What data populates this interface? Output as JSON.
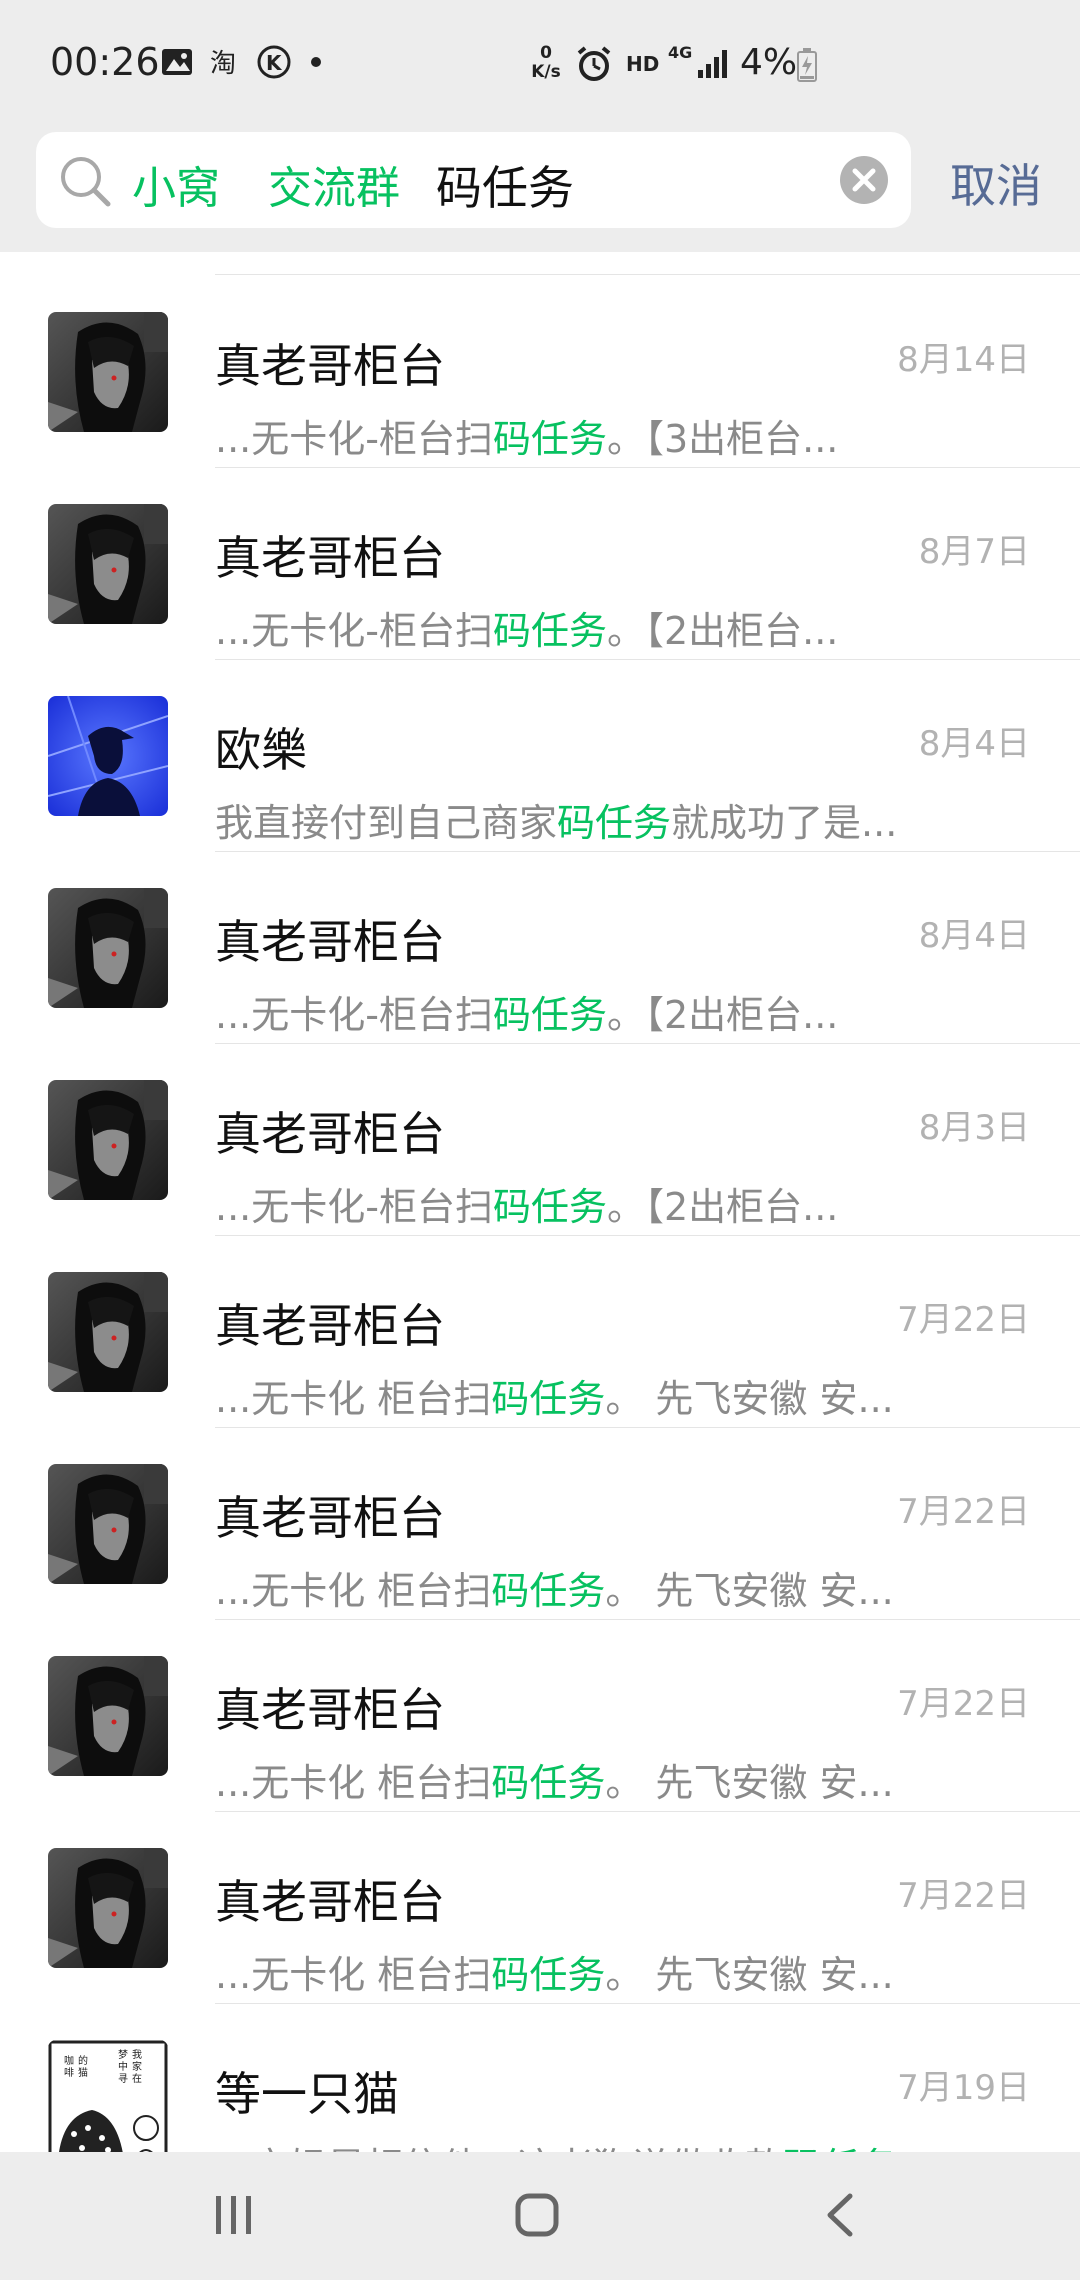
{
  "status_bar": {
    "time": "00:26",
    "net_speed_value": "0",
    "net_speed_unit": "K/s",
    "hd": "HD",
    "network": "4G",
    "battery": "4%"
  },
  "search": {
    "chips": [
      "小窝",
      "交流群"
    ],
    "query": "码任务",
    "cancel_label": "取消"
  },
  "results": [
    {
      "name": "真老哥柜台",
      "date": "8月14日",
      "avatar": "dark",
      "pre": "...无卡化-柜台扫",
      "hl": "码任务",
      "post": "。【3出柜台..."
    },
    {
      "name": "真老哥柜台",
      "date": "8月7日",
      "avatar": "dark",
      "pre": "...无卡化-柜台扫",
      "hl": "码任务",
      "post": "。【2出柜台..."
    },
    {
      "name": "欧樂",
      "date": "8月4日",
      "avatar": "blue",
      "pre": "我直接付到自己商家",
      "hl": "码任务",
      "post": "就成功了是..."
    },
    {
      "name": "真老哥柜台",
      "date": "8月4日",
      "avatar": "dark",
      "pre": "...无卡化-柜台扫",
      "hl": "码任务",
      "post": "。【2出柜台..."
    },
    {
      "name": "真老哥柜台",
      "date": "8月3日",
      "avatar": "dark",
      "pre": "...无卡化-柜台扫",
      "hl": "码任务",
      "post": "。【2出柜台..."
    },
    {
      "name": "真老哥柜台",
      "date": "7月22日",
      "avatar": "dark",
      "pre": "...无卡化 柜台扫",
      "hl": "码任务",
      "post": "。 先飞安徽 安..."
    },
    {
      "name": "真老哥柜台",
      "date": "7月22日",
      "avatar": "dark",
      "pre": "...无卡化 柜台扫",
      "hl": "码任务",
      "post": "。 先飞安徽 安..."
    },
    {
      "name": "真老哥柜台",
      "date": "7月22日",
      "avatar": "dark",
      "pre": "...无卡化 柜台扫",
      "hl": "码任务",
      "post": "。 先飞安徽 安..."
    },
    {
      "name": "真老哥柜台",
      "date": "7月22日",
      "avatar": "dark",
      "pre": "...无卡化 柜台扫",
      "hl": "码任务",
      "post": "。 先飞安徽 安..."
    },
    {
      "name": "等一只猫",
      "date": "7月19日",
      "avatar": "manga",
      "pre": "...宝妈是相信他，这老狗说做收款",
      "hl": "码任务",
      "post": ""
    }
  ],
  "colors": {
    "highlight": "#07c160",
    "cancel": "#576b95",
    "background": "#ededed"
  },
  "icons": {
    "status_left": [
      "image-icon",
      "taobao-icon",
      "k-icon",
      "dot-icon"
    ],
    "nav": [
      "recent-apps-icon",
      "home-icon",
      "back-icon"
    ]
  }
}
